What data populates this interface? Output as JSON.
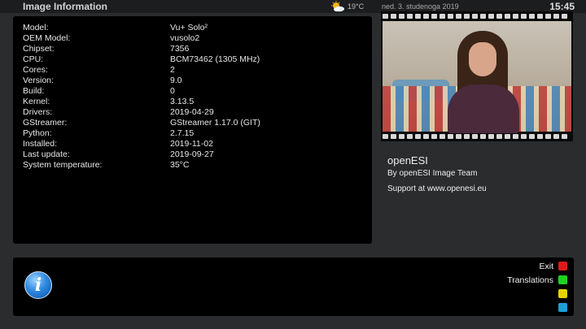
{
  "header": {
    "title": "Image Information",
    "weather_icon": "sun-cloud-icon",
    "weather_temp": "19°C",
    "date": "ned. 3. studenoga 2019",
    "time": "15:45"
  },
  "info_rows": [
    {
      "label": "Model:",
      "value": "Vu+ Solo²"
    },
    {
      "label": "OEM Model:",
      "value": "vusolo2"
    },
    {
      "label": "Chipset:",
      "value": "7356"
    },
    {
      "label": "CPU:",
      "value": "BCM73462   (1305 MHz)"
    },
    {
      "label": "Cores:",
      "value": "2"
    },
    {
      "label": "Version:",
      "value": "9.0"
    },
    {
      "label": "Build:",
      "value": "0"
    },
    {
      "label": "Kernel:",
      "value": "3.13.5"
    },
    {
      "label": "Drivers:",
      "value": "2019-04-29"
    },
    {
      "label": "GStreamer:",
      "value": "GStreamer 1.17.0 (GIT)"
    },
    {
      "label": "Python:",
      "value": "2.7.15"
    },
    {
      "label": "Installed:",
      "value": "2019-11-02"
    },
    {
      "label": "Last update:",
      "value": "2019-09-27"
    },
    {
      "label": "System temperature:",
      "value": "35°C"
    }
  ],
  "branding": {
    "name": "openESI",
    "team": "By openESI Image Team",
    "support": "Support at www.openesi.eu"
  },
  "keys": [
    {
      "label": "Exit",
      "color": "#e01818"
    },
    {
      "label": "Translations",
      "color": "#1ed21e"
    },
    {
      "label": "",
      "color": "#e6d200"
    },
    {
      "label": "",
      "color": "#1aa0d8"
    }
  ],
  "colors": {
    "background": "#2a2c2e",
    "panel": "#000000",
    "accent_blue": "#2f8ae0"
  }
}
